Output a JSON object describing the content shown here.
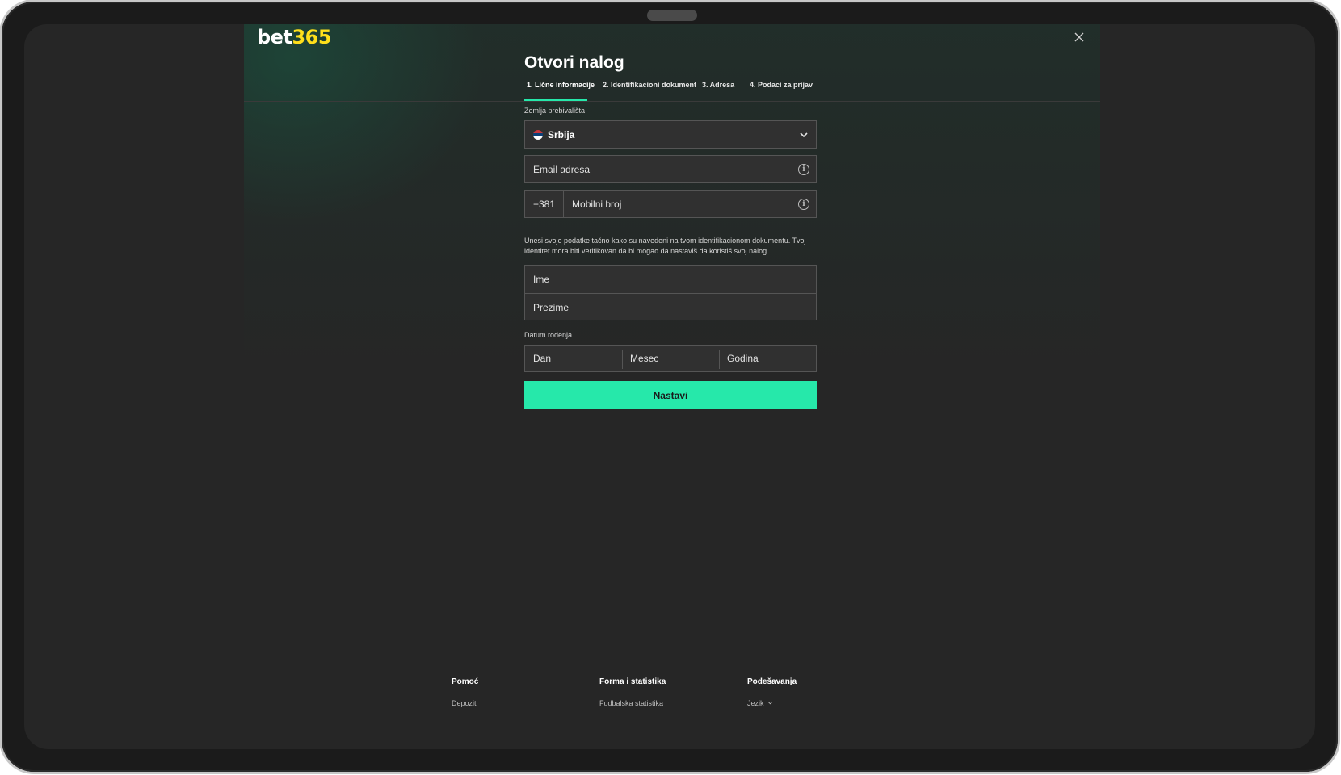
{
  "brand": {
    "logo_left": "bet",
    "logo_right": "365",
    "accent": "#26e8aa",
    "logo_accent": "#ffdf1b"
  },
  "header": {
    "close_icon": "close-icon"
  },
  "form": {
    "title": "Otvori nalog",
    "tabs": [
      {
        "label": "1. Lične informacije"
      },
      {
        "label": "2. Identifikacioni dokument"
      },
      {
        "label": "3. Adresa"
      },
      {
        "label": "4. Podaci za prijav"
      }
    ],
    "country": {
      "label": "Zemlja prebivališta",
      "value": "Srbija",
      "flag": "serbia-flag"
    },
    "email": {
      "placeholder": "Email adresa"
    },
    "phone": {
      "prefix": "+381",
      "placeholder": "Mobilni broj"
    },
    "notice": "Unesi svoje podatke tačno kako su navedeni na tvom identifikacionom dokumentu. Tvoj identitet mora biti verifikovan da bi mogao da nastaviš da koristiš svoj nalog.",
    "first_name": {
      "placeholder": "Ime"
    },
    "last_name": {
      "placeholder": "Prezime"
    },
    "dob": {
      "label": "Datum rođenja",
      "day": "Dan",
      "month": "Mesec",
      "year": "Godina"
    },
    "submit_label": "Nastavi"
  },
  "footer": {
    "columns": [
      {
        "title": "Pomoć",
        "link": "Depoziti"
      },
      {
        "title": "Forma i statistika",
        "link": "Fudbalska statistika"
      },
      {
        "title": "Podešavanja",
        "link": "Jezik"
      }
    ]
  }
}
